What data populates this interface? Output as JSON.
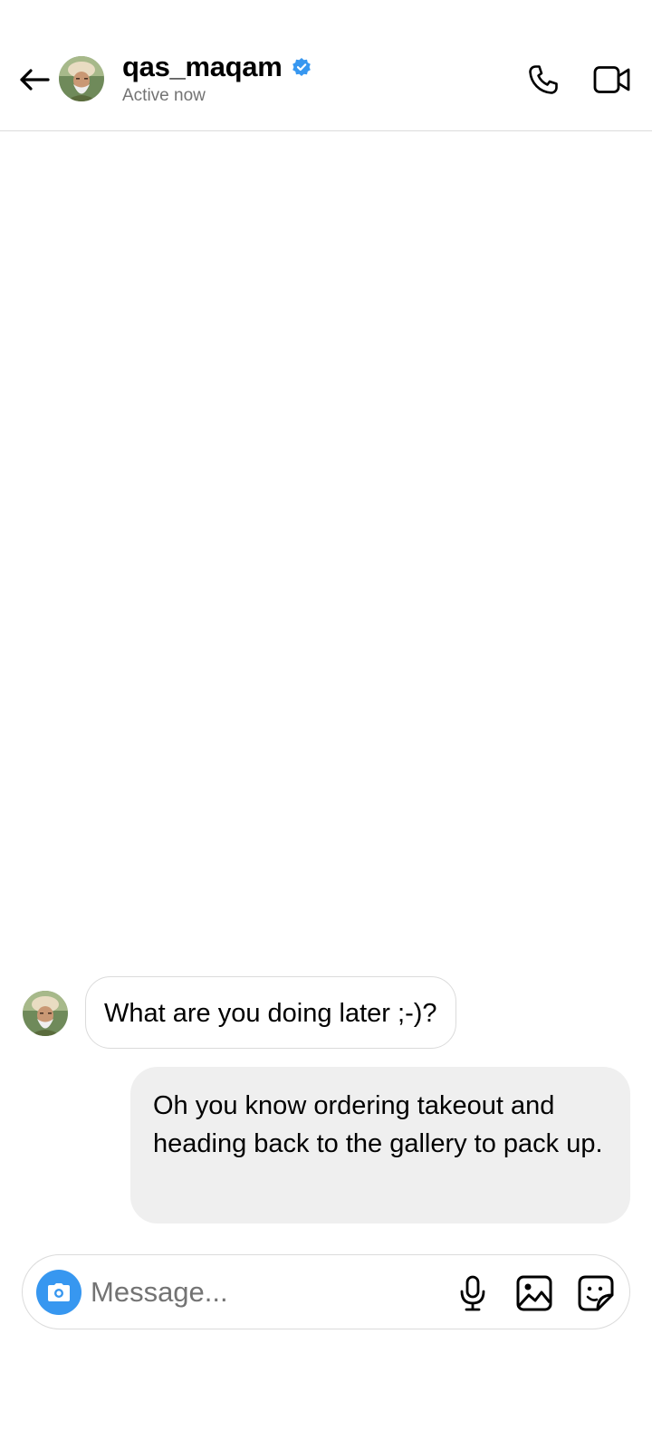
{
  "header": {
    "username": "qas_maqam",
    "status": "Active now",
    "verified": true,
    "back_icon": "arrow-left-icon",
    "call_icon": "phone-icon",
    "video_icon": "video-camera-icon"
  },
  "messages": [
    {
      "sender": "qas_maqam",
      "direction": "incoming",
      "text": "What are you doing later ;-)?"
    },
    {
      "sender": "me",
      "direction": "outgoing",
      "text": "Oh you know ordering takeout and heading back to the gallery to pack up."
    }
  ],
  "composer": {
    "placeholder": "Message...",
    "value": "",
    "camera_icon": "camera-icon",
    "mic_icon": "microphone-icon",
    "gallery_icon": "image-icon",
    "sticker_icon": "sticker-icon"
  },
  "colors": {
    "accent": "#3797f0",
    "outgoing_bubble": "#efefef",
    "border": "#dbdbdb",
    "secondary_text": "#737373"
  }
}
